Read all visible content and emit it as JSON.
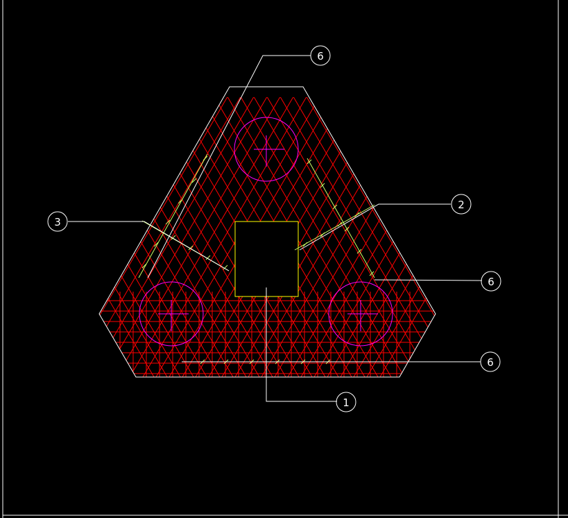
{
  "drawing": {
    "background_color": "#000000",
    "line_color": "#ffffff",
    "rebar_color": "#ff0000",
    "pile_color": "#ff00ff",
    "column_color": "#ffff00",
    "tie_color": "#ccff66"
  },
  "callouts": [
    {
      "id": "callout-top",
      "label": "6"
    },
    {
      "id": "callout-right-upper",
      "label": "2"
    },
    {
      "id": "callout-right-middle",
      "label": "6"
    },
    {
      "id": "callout-left",
      "label": "3"
    },
    {
      "id": "callout-right-lower",
      "label": "6"
    },
    {
      "id": "callout-bottom",
      "label": "1"
    }
  ],
  "piles": [
    {
      "id": "pile-top"
    },
    {
      "id": "pile-left"
    },
    {
      "id": "pile-right"
    }
  ]
}
